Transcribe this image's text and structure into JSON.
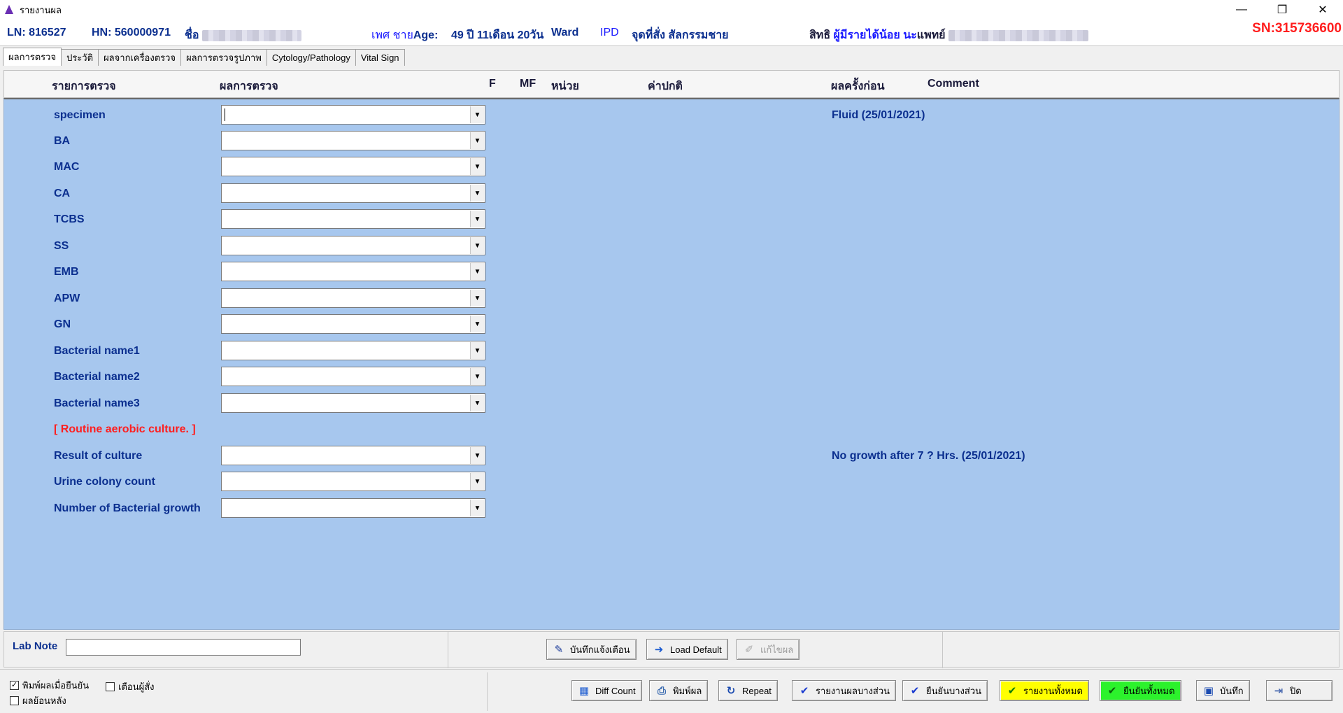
{
  "window": {
    "title": "รายงานผล",
    "controls": {
      "minimize": "—",
      "restore": "❐",
      "close": "✕"
    }
  },
  "header": {
    "ln_label": "LN: 816527",
    "hn_label": "HN: 560000971",
    "name_label": "ชื่อ",
    "sex_label": "เพศ",
    "sex_value": "ชาย",
    "age_label": "Age:",
    "age_value": "49 ปี  11เดือน 20วัน",
    "ward_label": "Ward",
    "ward_value": "IPD",
    "order_point": "จุดที่สั่ง สัลกรรมชาย",
    "rights_label": "สิทธิ",
    "rights_value": "ผู้มีรายได้น้อย นะ",
    "doctor_label": "แพทย์",
    "sn": "SN:315736600"
  },
  "tabs": [
    {
      "label": "ผลการตรวจ",
      "active": true
    },
    {
      "label": "ประวัติ",
      "active": false
    },
    {
      "label": "ผลจากเครื่องตรวจ",
      "active": false
    },
    {
      "label": "ผลการตรวจรูปภาพ",
      "active": false
    },
    {
      "label": "Cytology/Pathology",
      "active": false
    },
    {
      "label": "Vital Sign",
      "active": false
    }
  ],
  "columns": {
    "test": "รายการตรวจ",
    "result": "ผลการตรวจ",
    "f": "F",
    "mf": "MF",
    "unit": "หน่วย",
    "normal": "ค่าปกติ",
    "previous": "ผลครั้งก่อน",
    "comment": "Comment"
  },
  "rows": [
    {
      "label": "specimen",
      "combo": true,
      "previous": "Fluid (25/01/2021)",
      "focused": true
    },
    {
      "label": "BA",
      "combo": true,
      "previous": ""
    },
    {
      "label": "MAC",
      "combo": true,
      "previous": ""
    },
    {
      "label": "CA",
      "combo": true,
      "previous": ""
    },
    {
      "label": "TCBS",
      "combo": true,
      "previous": ""
    },
    {
      "label": "SS",
      "combo": true,
      "previous": ""
    },
    {
      "label": "EMB",
      "combo": true,
      "previous": ""
    },
    {
      "label": "APW",
      "combo": true,
      "previous": ""
    },
    {
      "label": "GN",
      "combo": true,
      "previous": ""
    },
    {
      "label": "Bacterial name1",
      "combo": true,
      "previous": ""
    },
    {
      "label": "Bacterial name2",
      "combo": true,
      "previous": ""
    },
    {
      "label": "Bacterial name3",
      "combo": true,
      "previous": ""
    },
    {
      "label": "[ Routine aerobic culture. ]",
      "combo": false,
      "section": true,
      "previous": ""
    },
    {
      "label": "Result of culture",
      "combo": true,
      "previous": "No growth after 7 ? Hrs. (25/01/2021)"
    },
    {
      "label": "Urine colony count",
      "combo": true,
      "previous": ""
    },
    {
      "label": "Number of Bacterial growth",
      "combo": true,
      "previous": ""
    }
  ],
  "lab_note": {
    "label": "Lab Note",
    "value": ""
  },
  "mid_buttons": {
    "save_warning": "บันทึกแจ้งเตือน",
    "load_default": "Load Default",
    "edit_result": "แก้ไขผล"
  },
  "checkboxes": {
    "print_on_confirm": {
      "label": "พิมพ์ผลเมื่อยืนยัน",
      "checked": true
    },
    "warn_orderer": {
      "label": "เตือนผู้สั่ง",
      "checked": false
    },
    "retro_result": {
      "label": "ผลย้อนหลัง",
      "checked": false
    }
  },
  "bottom_buttons": {
    "diff_count": "Diff Count",
    "print_result": "พิมพ์ผล",
    "repeat": "Repeat",
    "report_partial": "รายงานผลบางส่วน",
    "confirm_partial": "ยืนยันบางส่วน",
    "report_all": "รายงานทั้งหมด",
    "confirm_all": "ยืนยันทั้งหมด",
    "save": "บันทึก",
    "close": "ปิด"
  },
  "colors": {
    "grid_background": "#a7c7ee",
    "label_blue": "#0b2f8f",
    "section_red": "#ff1e1e",
    "report_all_yellow": "#ffff00",
    "confirm_all_green": "#2cf22c"
  }
}
